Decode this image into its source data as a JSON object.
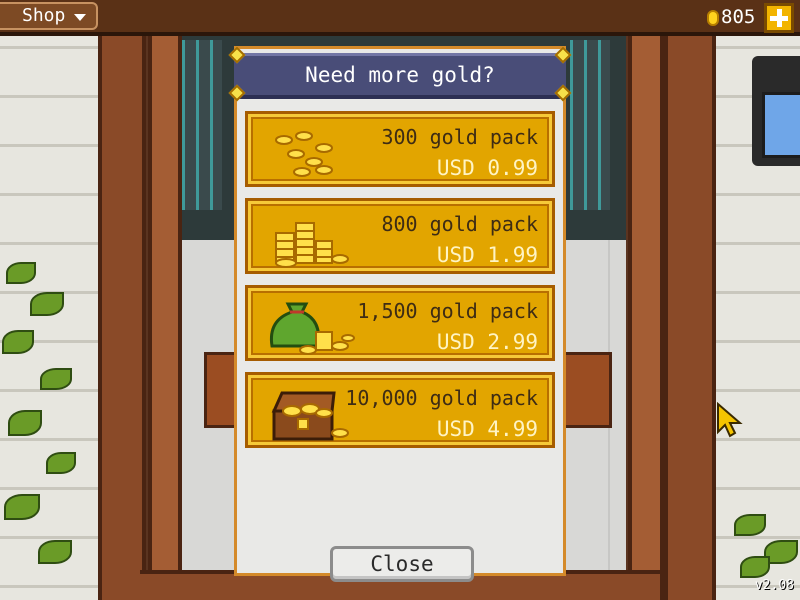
{
  "topbar": {
    "menu_label": "Shop",
    "gold_amount": "805"
  },
  "dialog": {
    "title": "Need more gold?",
    "packs": [
      {
        "name": "300 gold pack",
        "price": "USD 0.99",
        "icon": "coin-pile-icon"
      },
      {
        "name": "800 gold pack",
        "price": "USD 1.99",
        "icon": "coin-stacks-icon"
      },
      {
        "name": "1,500 gold pack",
        "price": "USD 2.99",
        "icon": "money-bag-icon"
      },
      {
        "name": "10,000 gold pack",
        "price": "USD 4.99",
        "icon": "treasure-chest-icon"
      }
    ],
    "close_label": "Close"
  },
  "version": "v2.08",
  "colors": {
    "pack_gold": "#e2a500",
    "header_blue": "#494d78",
    "topbar_brown": "#5a3116",
    "dialog_border": "#d48a2a"
  }
}
